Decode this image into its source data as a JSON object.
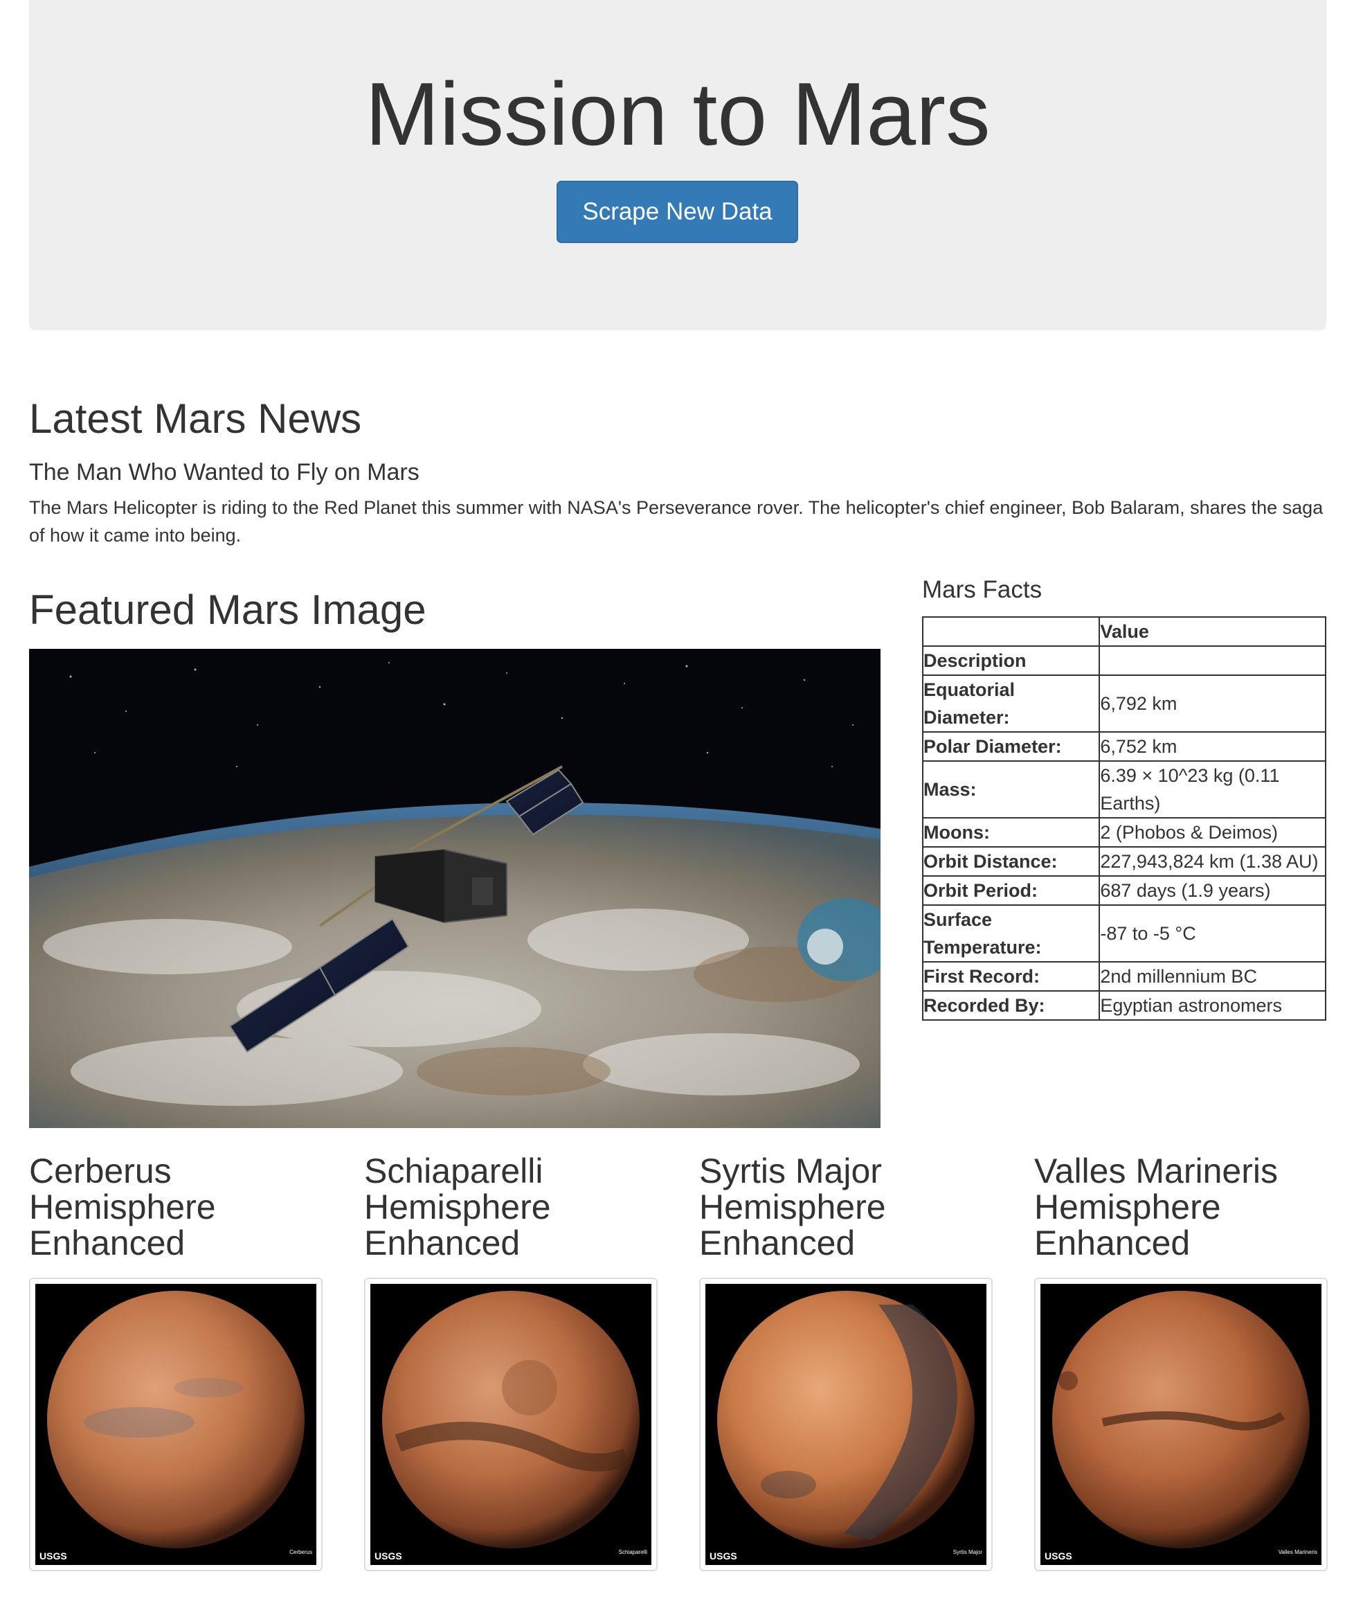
{
  "header": {
    "title": "Mission to Mars",
    "scrape_label": "Scrape New Data"
  },
  "news": {
    "heading": "Latest Mars News",
    "title": "The Man Who Wanted to Fly on Mars",
    "paragraph": "The Mars Helicopter is riding to the Red Planet this summer with NASA's Perseverance rover. The helicopter's chief engineer, Bob Balaram, shares the saga of how it came into being."
  },
  "featured": {
    "heading": "Featured Mars Image"
  },
  "facts": {
    "heading": "Mars Facts",
    "column_header": "Value",
    "rows": [
      {
        "label": "Description",
        "value": ""
      },
      {
        "label": "Equatorial Diameter:",
        "value": "6,792 km"
      },
      {
        "label": "Polar Diameter:",
        "value": "6,752 km"
      },
      {
        "label": "Mass:",
        "value": "6.39 × 10^23 kg (0.11 Earths)"
      },
      {
        "label": "Moons:",
        "value": "2 (Phobos & Deimos)"
      },
      {
        "label": "Orbit Distance:",
        "value": "227,943,824 km (1.38 AU)"
      },
      {
        "label": "Orbit Period:",
        "value": "687 days (1.9 years)"
      },
      {
        "label": "Surface Temperature:",
        "value": "-87 to -5 °C"
      },
      {
        "label": "First Record:",
        "value": "2nd millennium BC"
      },
      {
        "label": "Recorded By:",
        "value": "Egyptian astronomers"
      }
    ]
  },
  "hemispheres": [
    {
      "title": "Cerberus Hemisphere Enhanced",
      "caption": "Cerberus",
      "logo": "USGS"
    },
    {
      "title": "Schiaparelli Hemisphere Enhanced",
      "caption": "Schiaparelli",
      "logo": "USGS"
    },
    {
      "title": "Syrtis Major Hemisphere Enhanced",
      "caption": "Syrtis Major",
      "logo": "USGS"
    },
    {
      "title": "Valles Marineris Hemisphere Enhanced",
      "caption": "Valles Marineris",
      "logo": "USGS"
    }
  ]
}
